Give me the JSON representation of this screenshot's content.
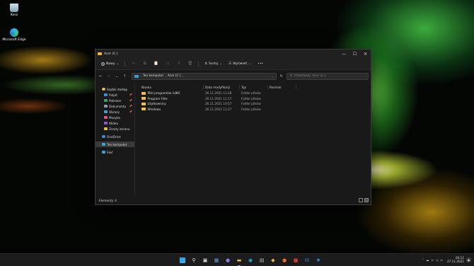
{
  "desktop": {
    "icons": [
      {
        "label": "Kosz",
        "icon": "recycle-bin-icon"
      },
      {
        "label": "Microsoft Edge",
        "icon": "edge-icon"
      }
    ]
  },
  "window": {
    "title": "Acer (C:)",
    "controls": {
      "minimize": "—",
      "maximize": "☐",
      "close": "✕"
    },
    "commandbar": {
      "new_label": "Nowy",
      "sort_label": "Sortuj",
      "view_label": "Wyświetl",
      "more_label": "•••"
    },
    "address": {
      "segments": [
        "Ten komputer",
        "Acer (C:)"
      ],
      "search_placeholder": "Przeszukaj: Acer (C:)"
    },
    "sidebar": {
      "quick_access": "Szybki dostęp",
      "quick_items": [
        {
          "label": "Pulpit",
          "color": "#3a8fd8"
        },
        {
          "label": "Pobrane",
          "color": "#3aa06a"
        },
        {
          "label": "Dokumenty",
          "color": "#8a9bb0"
        },
        {
          "label": "Obrazy",
          "color": "#3aa1d8"
        },
        {
          "label": "Muzyka",
          "color": "#e0508a"
        },
        {
          "label": "Wideo",
          "color": "#8a5ad8"
        },
        {
          "label": "Zrzuty ekranu",
          "color": "#e8b84a"
        }
      ],
      "onedrive": "OneDrive",
      "this_pc": "Ten komputer",
      "network": "Sieć"
    },
    "columns": {
      "name": "Nazwa",
      "date": "Data modyfikacji",
      "type": "Typ",
      "size": "Rozmiar"
    },
    "files": [
      {
        "name": "Pliki programów (x86)",
        "date": "26.11.2021 11:28",
        "type": "Folder plików"
      },
      {
        "name": "Program Files",
        "date": "26.11.2021 11:17",
        "type": "Folder plików"
      },
      {
        "name": "Użytkownicy",
        "date": "26.11.2021 10:57",
        "type": "Folder plików"
      },
      {
        "name": "Windows",
        "date": "26.11.2021 11:27",
        "type": "Folder plików"
      }
    ],
    "status": "Elementy: 4"
  },
  "taskbar": {
    "time": "00:11",
    "date": "27.11.2021"
  }
}
